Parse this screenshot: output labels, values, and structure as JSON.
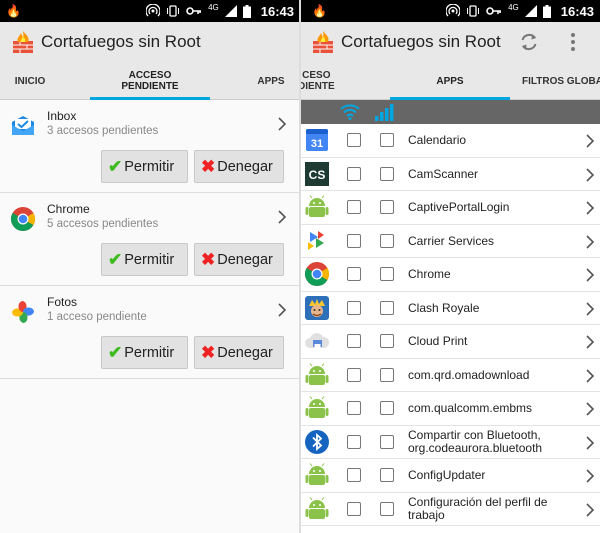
{
  "left": {
    "status": {
      "time": "16:43",
      "network": "4G"
    },
    "appbar": {
      "title": "Cortafuegos sin Root"
    },
    "tabs": [
      {
        "label": "INICIO"
      },
      {
        "label": "ACCESO PENDIENTE",
        "line1": "ACCESO",
        "line2": "PENDIENTE",
        "active": true
      },
      {
        "label": "APPS"
      }
    ],
    "pending": [
      {
        "app": "Inbox",
        "subtitle": "3 accesos pendientes",
        "icon": "inbox-icon",
        "allow": "Permitir",
        "deny": "Denegar"
      },
      {
        "app": "Chrome",
        "subtitle": "5 accesos pendientes",
        "icon": "chrome-icon",
        "allow": "Permitir",
        "deny": "Denegar"
      },
      {
        "app": "Fotos",
        "subtitle": "1 acceso pendiente",
        "icon": "photos-icon",
        "allow": "Permitir",
        "deny": "Denegar"
      }
    ]
  },
  "right": {
    "status": {
      "time": "16:43",
      "network": "4G"
    },
    "appbar": {
      "title": "Cortafuegos sin Root",
      "actions": [
        "refresh-icon",
        "more-vert-icon"
      ]
    },
    "tabs": [
      {
        "label": "ACCESO PENDIENTE",
        "line1": "CESO",
        "line2": "DIENTE"
      },
      {
        "label": "APPS",
        "active": true
      },
      {
        "label": "FILTROS GLOBALES",
        "visible": "FILTROS GLOBAL"
      }
    ],
    "column_icons": [
      "wifi-icon",
      "mobile-data-icon"
    ],
    "apps": [
      {
        "name": "Calendario",
        "icon": "calendar-icon",
        "icon_text": "31"
      },
      {
        "name": "CamScanner",
        "icon": "camscanner-icon",
        "icon_text": "CS"
      },
      {
        "name": "CaptivePortalLogin",
        "icon": "android-icon"
      },
      {
        "name": "Carrier Services",
        "icon": "carrier-services-icon"
      },
      {
        "name": "Chrome",
        "icon": "chrome-icon"
      },
      {
        "name": "Clash Royale",
        "icon": "clash-royale-icon"
      },
      {
        "name": "Cloud Print",
        "icon": "cloud-print-icon"
      },
      {
        "name": "com.qrd.omadownload",
        "icon": "android-icon"
      },
      {
        "name": "com.qualcomm.embms",
        "icon": "android-icon"
      },
      {
        "name": "Compartir con Bluetooth, org.codeaurora.bluetooth",
        "icon": "bluetooth-icon"
      },
      {
        "name": "ConfigUpdater",
        "icon": "android-icon"
      },
      {
        "name": "Configuración del perfil de trabajo",
        "icon": "android-icon"
      }
    ]
  },
  "colors": {
    "accent": "#00a6e0",
    "appbar": "#e8e8e8",
    "allow": "#3dbb1f",
    "deny": "#e22222",
    "netbar": "#666666"
  }
}
